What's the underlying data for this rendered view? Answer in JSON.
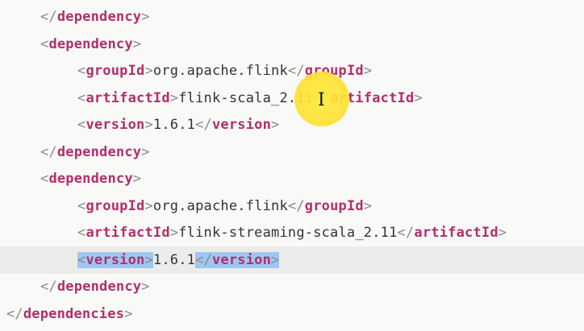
{
  "editor": {
    "lines": [
      {
        "kind": "close",
        "tag": "dependency",
        "indent": 1
      },
      {
        "kind": "open",
        "tag": "dependency",
        "indent": 1
      },
      {
        "kind": "element",
        "tag": "groupId",
        "text": "org.apache.flink",
        "indent": 2
      },
      {
        "kind": "element",
        "tag": "artifactId",
        "text": "flink-scala_2.11",
        "indent": 2
      },
      {
        "kind": "element",
        "tag": "version",
        "text": "1.6.1",
        "indent": 2
      },
      {
        "kind": "close",
        "tag": "dependency",
        "indent": 1
      },
      {
        "kind": "open",
        "tag": "dependency",
        "indent": 1
      },
      {
        "kind": "element",
        "tag": "groupId",
        "text": "org.apache.flink",
        "indent": 2
      },
      {
        "kind": "element",
        "tag": "artifactId",
        "text": "flink-streaming-scala_2.11",
        "indent": 2
      },
      {
        "kind": "element",
        "tag": "version",
        "text": "1.6.1",
        "indent": 2,
        "current": true,
        "highlight_tags": true
      },
      {
        "kind": "close",
        "tag": "dependency",
        "indent": 1
      },
      {
        "kind": "close",
        "tag": "dependencies",
        "indent": 0
      }
    ]
  },
  "colors": {
    "background": "#f9f9f7",
    "tag": "#b0306a",
    "bracket": "#8a8a8a",
    "text": "#333333",
    "current_line": "#ececea",
    "match_highlight": "#9fc6f2",
    "cursor_spot": "#ffe135"
  },
  "icons": {
    "cursor": "text-cursor-icon"
  }
}
